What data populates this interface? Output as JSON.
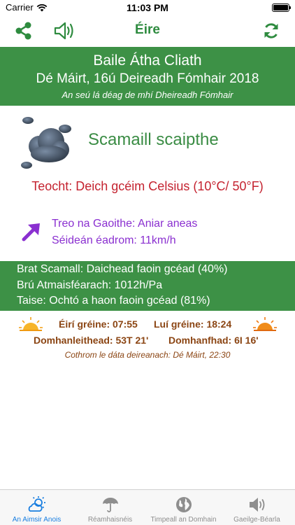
{
  "status_bar": {
    "carrier": "Carrier",
    "time": "11:03 PM"
  },
  "navbar": {
    "title": "Éire",
    "share_icon": "share-icon",
    "sound_icon": "speaker-icon",
    "refresh_icon": "refresh-icon"
  },
  "header": {
    "city": "Baile Átha Cliath",
    "date": "Dé Máirt, 16ú Deireadh Fómhair 2018",
    "date_long": "An seú lá déag de mhí Dheireadh Fómhair"
  },
  "weather": {
    "icon": "cloud-icon",
    "condition": "Scamaill scaipthe",
    "temperature": "Teocht: Deich gcéim Celsius (10°C/ 50°F)",
    "wind_direction": "Treo na Gaoithe: Aniar aneas",
    "wind_speed": "Séideán éadrom: 11km/h"
  },
  "details": {
    "cloud_cover": "Brat Scamall: Daichead faoin gcéad (40%)",
    "pressure": "Brú Atmaisféarach: 1012h/Pa",
    "humidity": "Taise: Ochtó a haon faoin gcéad (81%)"
  },
  "sun": {
    "sunrise": "Éirí gréine: 07:55",
    "sunset": "Luí gréine: 18:24",
    "latitude": "Domhanleithead: 53T 21'",
    "longitude": "Domhanfhad: 6I 16'",
    "updated": "Cothrom le dáta deireanach: Dé Máirt, 22:30"
  },
  "tabs": [
    {
      "label": "An Aimsir Anois",
      "icon": "weather-now-icon",
      "active": true
    },
    {
      "label": "Réamhaisnéis",
      "icon": "umbrella-icon",
      "active": false
    },
    {
      "label": "Timpeall an Domhain",
      "icon": "globe-icon",
      "active": false
    },
    {
      "label": "Gaeilge-Béarla",
      "icon": "speaker-icon",
      "active": false
    }
  ],
  "colors": {
    "green": "#3d9146",
    "red": "#c4222f",
    "purple": "#8a2fd0",
    "brown": "#8b4513",
    "tab_active": "#1a7fe0"
  }
}
